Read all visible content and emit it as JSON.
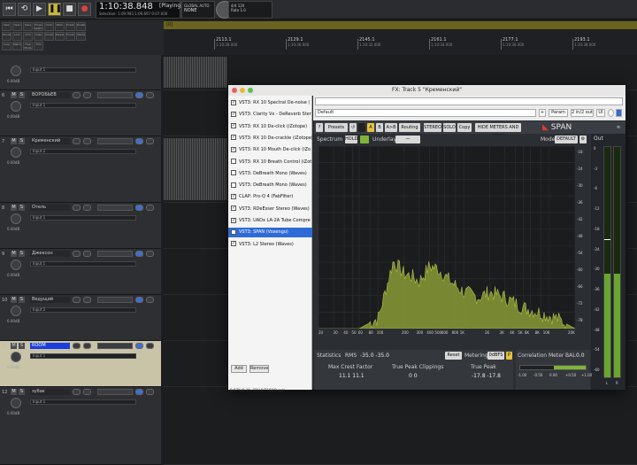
{
  "transport": {
    "time": "1:10:38.848",
    "state": "[Playing]",
    "selection_label": "Selection:",
    "sel_start": "1:09.993",
    "sel_end": "1:09.697",
    "sel_len": "0:07.000",
    "global_label": "GLOBAL AUTO",
    "global_value": "NONE",
    "bpm_label": "4/4",
    "bpm_value": "120",
    "rate_label": "Rate",
    "rate_value": "1.0"
  },
  "toolbar": {
    "tools": [
      "New",
      "Open",
      "Save",
      "Project Settings",
      "Undo",
      "Redo",
      "Enable",
      "Disable",
      "Render",
      "Lock",
      "Grid",
      "Snap",
      "Crossfade",
      "Ripple",
      "Envelope",
      "Markers",
      "Loop",
      "Metronome",
      "Free Mode",
      "Trim"
    ]
  },
  "timeline": {
    "marker": "[0]",
    "ticks": [
      {
        "bar": "2113.1",
        "time": "1:10:28.000"
      },
      {
        "bar": "2129.1",
        "time": "1:10:30.000"
      },
      {
        "bar": "2145.1",
        "time": "1:10:32.000"
      },
      {
        "bar": "2161.1",
        "time": "1:10:34.000"
      },
      {
        "bar": "2177.1",
        "time": "1:10:36.000"
      },
      {
        "bar": "2193.1",
        "time": "1:10:38.000"
      }
    ]
  },
  "tracks": [
    {
      "num": "",
      "name": "",
      "input": "Input 1",
      "vol": "0.00dB",
      "height": 40
    },
    {
      "num": "6",
      "name": "ВОРОБЬЁВ МУЗЫКА",
      "input": "Input 1",
      "vol": "0.00dB",
      "height": 52
    },
    {
      "num": "7",
      "name": "Кременский",
      "input": "Input 2",
      "vol": "0.00dB",
      "height": 75
    },
    {
      "num": "8",
      "name": "Отель",
      "input": "Input 1",
      "vol": "0.00dB",
      "height": 52
    },
    {
      "num": "9",
      "name": "Джексон",
      "input": "Input 1",
      "vol": "0.00dB",
      "height": 52
    },
    {
      "num": "10",
      "name": "Ведущий",
      "input": "Input 2",
      "vol": "0.00dB",
      "height": 52
    },
    {
      "num": "11",
      "name": "ROOM",
      "input": "Input 1",
      "vol": "0.00dB",
      "height": 52
    },
    {
      "num": "12",
      "name": "зубак",
      "input": "Input 1",
      "vol": "0.00dB",
      "height": 88
    }
  ],
  "fx": {
    "title": "FX: Track 5 \"Кременский\"",
    "chain": [
      {
        "label": "VST3: RX 10 Spectral De-noise (",
        "checked": true
      },
      {
        "label": "VST3: Clarity Vx - DeReverb Ster",
        "checked": true
      },
      {
        "label": "VST3: RX 10 De-click (iZotope)",
        "checked": true
      },
      {
        "label": "VST3: RX 10 De-crackle (iZotope)",
        "checked": true
      },
      {
        "label": "VST3: RX 10 Mouth De-click (iZo",
        "checked": true
      },
      {
        "label": "VST3: RX 10 Breath Control (iZot",
        "checked": false
      },
      {
        "label": "VST3: DeBreath Mono (Waves)",
        "checked": false
      },
      {
        "label": "VST3: DeBreath Mono (Waves)",
        "checked": false
      },
      {
        "label": "CLAP: Pro-Q 4 (FabFilter)",
        "checked": true
      },
      {
        "label": "VST3: RDeEsser Stereo (Waves)",
        "checked": true
      },
      {
        "label": "VST3: UADx LA-2A Tube Compre",
        "checked": true
      },
      {
        "label": "VST3: SPAN (Voxengo)",
        "checked": true,
        "selected": true
      },
      {
        "label": "VST3: L2 Stereo (Waves)",
        "checked": true
      }
    ],
    "add_label": "Add",
    "remove_label": "Remove",
    "cpu": "0.07%/0.1% CPU 0/7168/0 spls",
    "preset_value": "Default",
    "param_label": "Param",
    "io_label": "2 in/2 out",
    "ui_label": "UI"
  },
  "span": {
    "help": "?",
    "presets": "Presets",
    "ab_a": "A",
    "ab_b": "B",
    "ab_copy": "A>B",
    "routing": "Routing",
    "stereo": "STEREO",
    "solo": "SOLO",
    "copy": "Copy",
    "hide": "HIDE METERS AND STATS",
    "logo": "SPAN",
    "spectrum_label": "Spectrum",
    "hold_label": "HOLD",
    "underlay_label": "Underlay",
    "mode_label": "Mode",
    "mode_value": "DEFAULT",
    "out_label": "Out",
    "db_ticks": [
      "-18",
      "-24",
      "-30",
      "-36",
      "-42",
      "-48",
      "-54",
      "-60",
      "-66",
      "-72",
      "-78"
    ],
    "freq_ticks": [
      "20",
      "30",
      "40",
      "50",
      "60",
      "80",
      "100",
      "200",
      "300",
      "400",
      "500",
      "600",
      "800",
      "1K",
      "2K",
      "3K",
      "4K",
      "5K",
      "6K",
      "8K",
      "10K",
      "20K"
    ],
    "stats_label": "Statistics",
    "rms_label": "RMS",
    "rms_value": "-35.0  -35.0",
    "reset_label": "Reset",
    "metering_label": "Metering",
    "metering_value": "0dBFS",
    "metering_p": "P",
    "crest_label": "Max Crest Factor",
    "crest_value": "11.1   11.1",
    "clip_label": "True Peak Clippings",
    "clip_value": "0      0",
    "tpeak_label": "True Peak",
    "tpeak_value": "-17.8  -17.8",
    "corr_label": "Correlation Meter",
    "bal_label": "BAL",
    "bal_value": "0.0",
    "corr_ticks": [
      "-1.00",
      "-0.50",
      "0.00",
      "+0.50",
      "+1.00"
    ],
    "out_ticks": [
      "0",
      "-3",
      "-6",
      "-12",
      "-18",
      "-24",
      "-30",
      "-36",
      "-42",
      "-48",
      "-54",
      "-60"
    ],
    "out_lr": [
      "L",
      "R"
    ],
    "spectrum_color": "#8a9a35"
  },
  "chart_data": {
    "type": "area",
    "x": [
      20,
      40,
      60,
      100,
      150,
      200,
      250,
      300,
      400,
      500,
      700,
      1000,
      1500,
      2000,
      3000,
      5000,
      8000,
      12000,
      20000
    ],
    "values": [
      -84,
      -84,
      -84,
      -80,
      -58,
      -63,
      -64,
      -66,
      -60,
      -61,
      -66,
      -70,
      -72,
      -70,
      -72,
      -76,
      -78,
      -80,
      -84
    ],
    "xlabel": "",
    "ylabel": "",
    "ylim": [
      -84,
      -14
    ],
    "x_scale": "log"
  }
}
